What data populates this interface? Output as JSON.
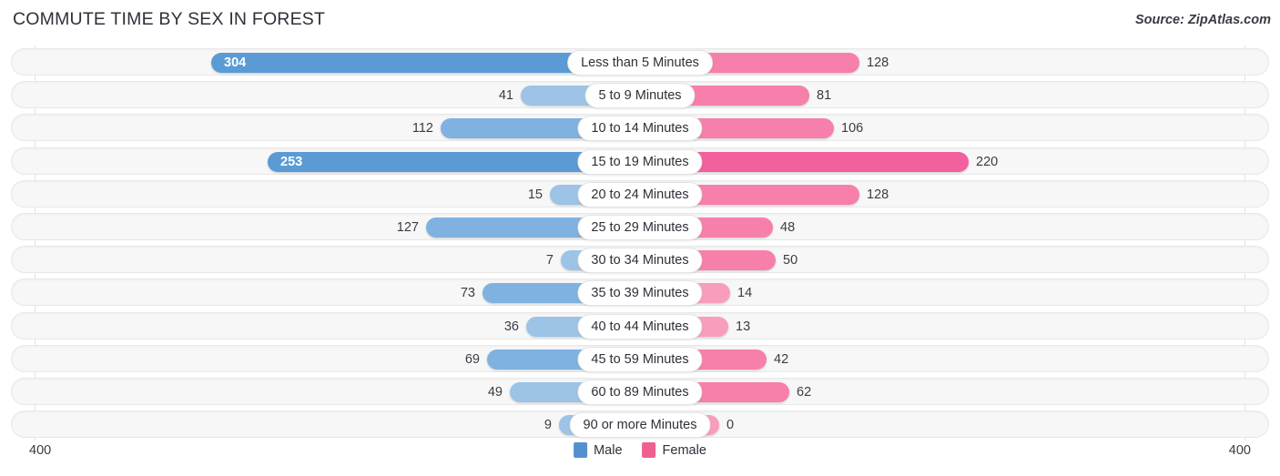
{
  "header": {
    "title": "COMMUTE TIME BY SEX IN FOREST",
    "source": "Source: ZipAtlas.com"
  },
  "axis": {
    "left_tick": "400",
    "right_tick": "400"
  },
  "legend": {
    "items": [
      {
        "label": "Male",
        "color": "#5490d0"
      },
      {
        "label": "Female",
        "color": "#ef5f91"
      }
    ]
  },
  "chart_data": {
    "type": "bar",
    "orientation": "horizontal",
    "layout": "diverging-bidirectional",
    "title": "COMMUTE TIME BY SEX IN FOREST",
    "source": "Source: ZipAtlas.com",
    "xlabel": "",
    "ylabel": "",
    "xlim": [
      400,
      400
    ],
    "axis_max": 400,
    "grid": false,
    "legend_position": "bottom-center",
    "categories": [
      "Less than 5 Minutes",
      "5 to 9 Minutes",
      "10 to 14 Minutes",
      "15 to 19 Minutes",
      "20 to 24 Minutes",
      "25 to 29 Minutes",
      "30 to 34 Minutes",
      "35 to 39 Minutes",
      "40 to 44 Minutes",
      "45 to 59 Minutes",
      "60 to 89 Minutes",
      "90 or more Minutes"
    ],
    "series": [
      {
        "name": "Male",
        "color": "#5490d0",
        "direction": "left",
        "values": [
          304,
          41,
          112,
          253,
          15,
          127,
          7,
          73,
          36,
          69,
          49,
          9
        ]
      },
      {
        "name": "Female",
        "color": "#ef5f91",
        "direction": "right",
        "values": [
          128,
          81,
          106,
          220,
          128,
          48,
          50,
          14,
          13,
          42,
          62,
          0
        ]
      }
    ]
  },
  "rows": [
    {
      "category": "Less than 5 Minutes",
      "male": "304",
      "male_w": 470,
      "male_shade": "dark",
      "male_label_inside": true,
      "female": "128",
      "female_w": 240,
      "female_shade": "mid"
    },
    {
      "category": "5 to 9 Minutes",
      "male": "41",
      "male_w": 130,
      "male_shade": "light",
      "male_label_inside": false,
      "female": "81",
      "female_w": 185,
      "female_shade": "mid"
    },
    {
      "category": "10 to 14 Minutes",
      "male": "112",
      "male_w": 218,
      "male_shade": "mid",
      "male_label_inside": false,
      "female": "106",
      "female_w": 212,
      "female_shade": "mid"
    },
    {
      "category": "15 to 19 Minutes",
      "male": "253",
      "male_w": 408,
      "male_shade": "dark",
      "male_label_inside": true,
      "female": "220",
      "female_w": 360,
      "female_shade": "dark"
    },
    {
      "category": "20 to 24 Minutes",
      "male": "15",
      "male_w": 98,
      "male_shade": "light",
      "male_label_inside": false,
      "female": "128",
      "female_w": 240,
      "female_shade": "mid"
    },
    {
      "category": "25 to 29 Minutes",
      "male": "127",
      "male_w": 234,
      "male_shade": "mid",
      "male_label_inside": false,
      "female": "48",
      "female_w": 145,
      "female_shade": "mid"
    },
    {
      "category": "30 to 34 Minutes",
      "male": "7",
      "male_w": 86,
      "male_shade": "light",
      "male_label_inside": false,
      "female": "50",
      "female_w": 148,
      "female_shade": "mid"
    },
    {
      "category": "35 to 39 Minutes",
      "male": "73",
      "male_w": 172,
      "male_shade": "mid",
      "male_label_inside": false,
      "female": "14",
      "female_w": 98,
      "female_shade": "light"
    },
    {
      "category": "40 to 44 Minutes",
      "male": "36",
      "male_w": 124,
      "male_shade": "light",
      "male_label_inside": false,
      "female": "13",
      "female_w": 96,
      "female_shade": "light"
    },
    {
      "category": "45 to 59 Minutes",
      "male": "69",
      "male_w": 167,
      "male_shade": "mid",
      "male_label_inside": false,
      "female": "42",
      "female_w": 138,
      "female_shade": "mid"
    },
    {
      "category": "60 to 89 Minutes",
      "male": "49",
      "male_w": 142,
      "male_shade": "light",
      "male_label_inside": false,
      "female": "62",
      "female_w": 163,
      "female_shade": "mid"
    },
    {
      "category": "90 or more Minutes",
      "male": "9",
      "male_w": 88,
      "male_shade": "light",
      "male_label_inside": false,
      "female": "0",
      "female_w": 86,
      "female_shade": "light"
    }
  ]
}
